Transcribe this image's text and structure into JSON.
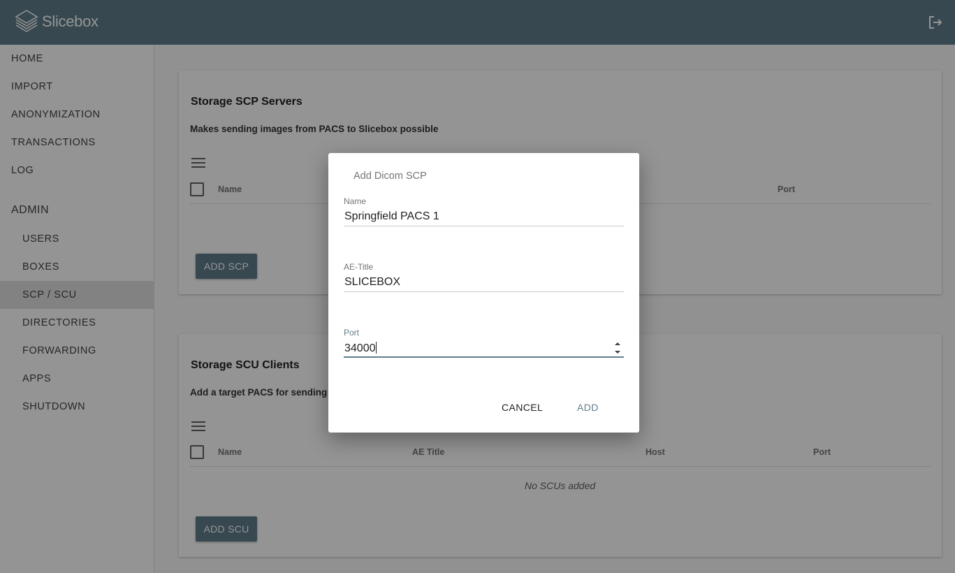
{
  "app": {
    "title": "Slicebox"
  },
  "icons": {
    "logo": "slicebox-logo-icon",
    "logout": "logout-icon",
    "menu": "menu-icon"
  },
  "colors": {
    "primary": "#607d8b",
    "active_nav": "#e0e0e0"
  },
  "sidebar": {
    "items": [
      {
        "label": "HOME"
      },
      {
        "label": "IMPORT"
      },
      {
        "label": "ANONYMIZATION"
      },
      {
        "label": "TRANSACTIONS"
      },
      {
        "label": "LOG"
      }
    ],
    "admin_heading": "ADMIN",
    "admin_items": [
      {
        "label": "USERS"
      },
      {
        "label": "BOXES"
      },
      {
        "label": "SCP / SCU",
        "active": true
      },
      {
        "label": "DIRECTORIES"
      },
      {
        "label": "FORWARDING"
      },
      {
        "label": "APPS"
      },
      {
        "label": "SHUTDOWN"
      }
    ]
  },
  "scp_card": {
    "title": "Storage SCP Servers",
    "subtitle": "Makes sending images from PACS to Slicebox possible",
    "columns": [
      "Name",
      "Port"
    ],
    "button": "ADD SCP"
  },
  "scu_card": {
    "title": "Storage SCU Clients",
    "subtitle": "Add a target PACS for sending images",
    "columns": [
      "Name",
      "AE Title",
      "Host",
      "Port"
    ],
    "empty_message": "No SCUs added",
    "button": "ADD SCU"
  },
  "dialog": {
    "title": "Add Dicom SCP",
    "fields": [
      {
        "label": "Name",
        "value": "Springfield PACS 1"
      },
      {
        "label": "AE-Title",
        "value": "SLICEBOX"
      },
      {
        "label": "Port",
        "value": "34000"
      }
    ],
    "cancel_label": "CANCEL",
    "add_label": "ADD"
  }
}
